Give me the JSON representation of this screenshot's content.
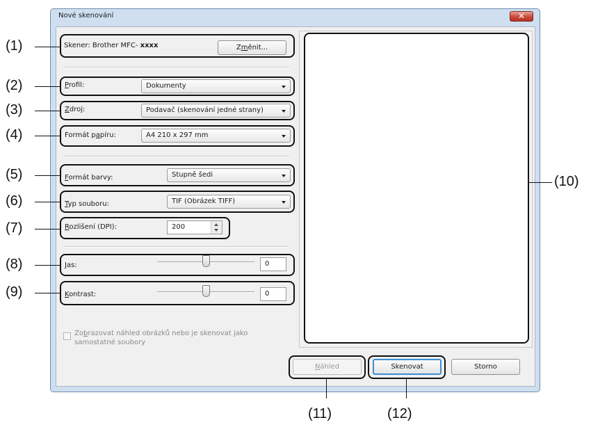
{
  "window": {
    "title": "Nové skenování",
    "close_glyph": "✕"
  },
  "scanner": {
    "label": "Skener: Brother MFC- ",
    "model": "xxxx",
    "change_button": {
      "before": "Z",
      "accel": "m",
      "after": "ěnit..."
    }
  },
  "profile": {
    "label": {
      "accel": "P",
      "rest": "rofil:"
    },
    "value": "Dokumenty"
  },
  "source": {
    "label": {
      "accel": "Z",
      "rest": "droj:"
    },
    "value": "Podavač (skenování jedné strany)"
  },
  "paper_format": {
    "label": {
      "before": "Formát p",
      "accel": "a",
      "after": "píru:"
    },
    "value": "A4 210 x 297 mm"
  },
  "color_format": {
    "label": {
      "accel": "F",
      "rest": "ormát barvy:"
    },
    "value": "Stupně šedi"
  },
  "file_type": {
    "label": {
      "accel": "T",
      "rest": "yp souboru:"
    },
    "value": "TIF (Obrázek TIFF)"
  },
  "resolution": {
    "label": {
      "accel": "R",
      "rest": "ozlišení (DPI):"
    },
    "value": "200"
  },
  "brightness": {
    "label": {
      "accel": "J",
      "rest": "as:"
    },
    "value": "0",
    "level": 0.5
  },
  "contrast": {
    "label": {
      "accel": "K",
      "rest": "ontrast:"
    },
    "value": "0",
    "level": 0.5
  },
  "preview_option": {
    "before": "Zo",
    "accel": "b",
    "after": "razovat náhled obrázků nebo je skenovat jako",
    "line2": "samostatné soubory",
    "checked": false
  },
  "buttons": {
    "preview": {
      "accel": "N",
      "rest": "áhled",
      "enabled": false
    },
    "scan": "Skenovat",
    "cancel": "Storno"
  },
  "annotations": [
    "(1)",
    "(2)",
    "(3)",
    "(4)",
    "(5)",
    "(6)",
    "(7)",
    "(8)",
    "(9)",
    "(10)",
    "(11)",
    "(12)"
  ]
}
